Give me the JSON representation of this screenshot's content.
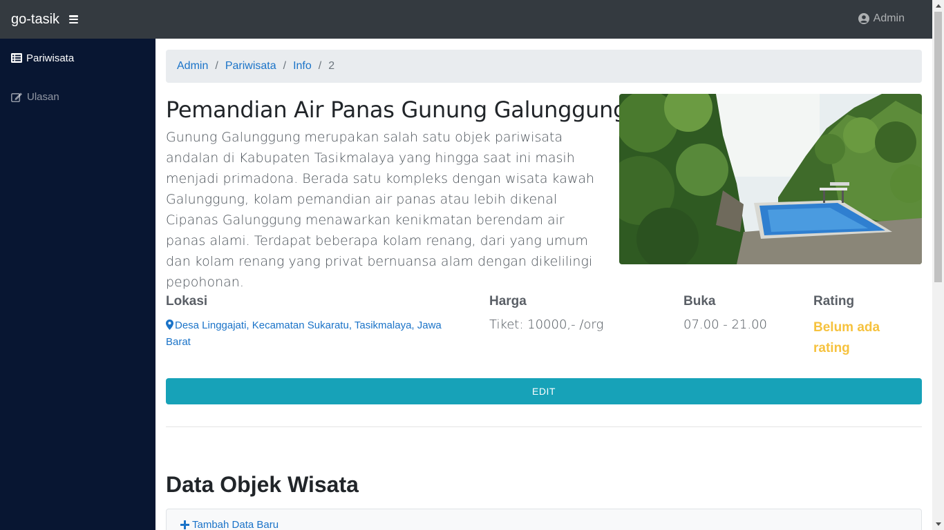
{
  "navbar": {
    "brand": "go-tasik",
    "user": "Admin"
  },
  "sidebar": {
    "items": [
      {
        "label": "Pariwisata",
        "icon": "list-icon"
      },
      {
        "label": "Ulasan",
        "icon": "edit-icon"
      }
    ]
  },
  "breadcrumb": {
    "items": [
      "Admin",
      "Pariwisata",
      "Info"
    ],
    "current": "2"
  },
  "detail": {
    "title": "Pemandian Air Panas Gunung Galunggung",
    "description": "Gunung Galunggung merupakan salah satu objek pariwisata andalan di Kabupaten Tasikmalaya yang hingga saat ini masih menjadi primadona. Berada satu kompleks dengan wisata kawah Galunggung, kolam pemandian air panas atau lebih dikenal Cipanas Galunggung menawarkan kenikmatan berendam air panas alami. Terdapat beberapa kolam renang, dari yang umum dan kolam renang yang privat bernuansa alam dengan dikelilingi pepohonan.",
    "lokasi_label": "Lokasi",
    "lokasi_value": "Desa Linggajati, Kecamatan Sukaratu, Tasikmalaya, Jawa Barat",
    "harga_label": "Harga",
    "harga_value": "Tiket: 10000,- /org",
    "buka_label": "Buka",
    "buka_value": "07.00 - 21.00",
    "rating_label": "Rating",
    "rating_value": "Belum ada rating",
    "edit_label": "EDIT"
  },
  "section": {
    "title": "Data Objek Wisata",
    "add_label": "Tambah Data Baru"
  },
  "colors": {
    "navbar": "#343a40",
    "sidebar": "#081632",
    "accent": "#17a2b8",
    "link": "#1a73c8",
    "rating": "#f6c23e"
  }
}
